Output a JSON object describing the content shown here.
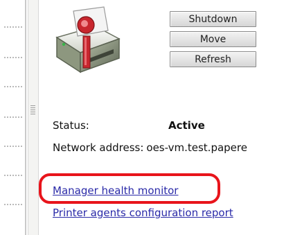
{
  "actions": {
    "shutdown_label": "Shutdown",
    "move_label": "Move",
    "refresh_label": "Refresh"
  },
  "status": {
    "label": "Status:",
    "value": "Active"
  },
  "network": {
    "label": "Network address:",
    "value": "oes-vm.test.papere"
  },
  "links": {
    "health_monitor": "Manager health monitor",
    "agents_report": "Printer agents configuration report"
  },
  "icons": {
    "printer": "printer-manager-icon"
  },
  "colors": {
    "link": "#2a2aa8",
    "highlight": "#e8141b",
    "printer_accent": "#c8262e"
  }
}
